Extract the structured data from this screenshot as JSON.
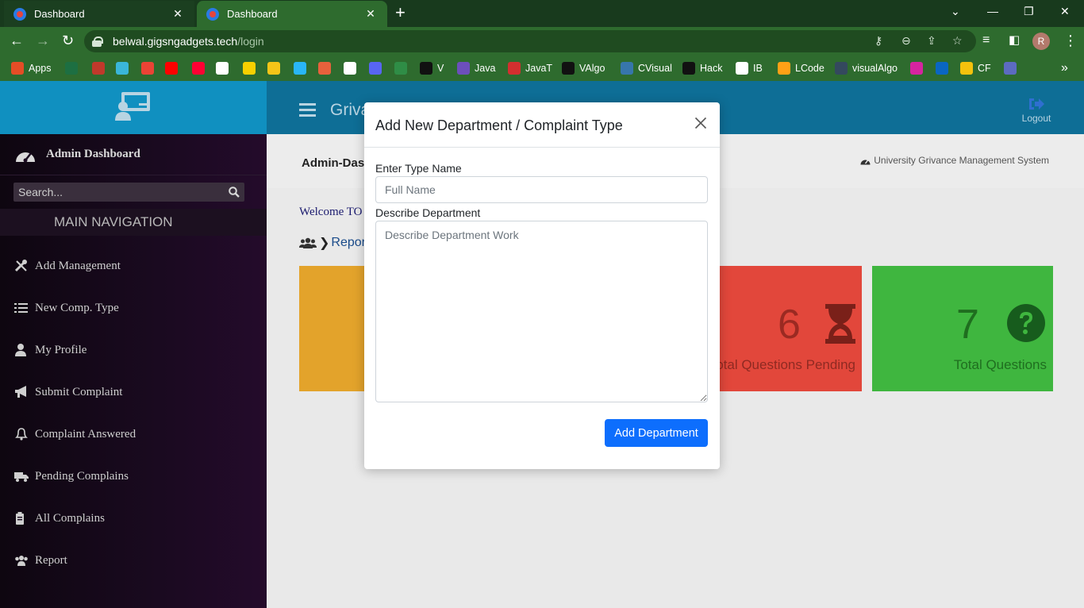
{
  "browser": {
    "tabs": [
      {
        "title": "Dashboard",
        "active": false
      },
      {
        "title": "Dashboard",
        "active": true
      }
    ],
    "url_host": "belwal.gigsngadgets.tech",
    "url_path": "/login",
    "profile_initial": "R",
    "bookmarks": [
      {
        "label": "Apps",
        "icon": "apps-grid-icon",
        "color": "#e44d26"
      },
      {
        "label": "",
        "icon": "excel-icon",
        "color": "#1d6f42"
      },
      {
        "label": "",
        "icon": "bookmark-red-icon",
        "color": "#c0392b"
      },
      {
        "label": "",
        "icon": "bookmark-teal-icon",
        "color": "#3ab6d9"
      },
      {
        "label": "",
        "icon": "gmail-icon",
        "color": "#ea4335"
      },
      {
        "label": "",
        "icon": "youtube-icon",
        "color": "#ff0000"
      },
      {
        "label": "",
        "icon": "youtube-music-icon",
        "color": "#ff0033"
      },
      {
        "label": "",
        "icon": "amazon-icon",
        "color": "#ffffff"
      },
      {
        "label": "",
        "icon": "flipkart-icon",
        "color": "#f7d000"
      },
      {
        "label": "",
        "icon": "p-icon",
        "color": "#f5c518"
      },
      {
        "label": "",
        "icon": "arrow-bookmark-icon",
        "color": "#29b6f6"
      },
      {
        "label": "",
        "icon": "code-icon",
        "color": "#e8613c"
      },
      {
        "label": "",
        "icon": "github-icon",
        "color": "#ffffff"
      },
      {
        "label": "",
        "icon": "discord-icon",
        "color": "#5865f2"
      },
      {
        "label": "",
        "icon": "gfg-icon",
        "color": "#2f8d46"
      },
      {
        "label": "V",
        "icon": "v-icon",
        "color": "#111111"
      },
      {
        "label": "Java",
        "icon": "java-icon",
        "color": "#6c4fbb"
      },
      {
        "label": "JavaT",
        "icon": "javat-icon",
        "color": "#d32f2f"
      },
      {
        "label": "VAlgo",
        "icon": "valgo-icon",
        "color": "#111111"
      },
      {
        "label": "CVisual",
        "icon": "python-icon",
        "color": "#3776ab"
      },
      {
        "label": "Hack",
        "icon": "hackerrank-icon",
        "color": "#111111"
      },
      {
        "label": "IB",
        "icon": "ib-icon",
        "color": "#ffffff"
      },
      {
        "label": "LCode",
        "icon": "leetcode-icon",
        "color": "#ffa116"
      },
      {
        "label": "visualAlgo",
        "icon": "visualalgo-icon",
        "color": "#34495e"
      },
      {
        "label": "",
        "icon": "instagram-icon",
        "color": "#d6249f"
      },
      {
        "label": "",
        "icon": "linkedin-icon",
        "color": "#0a66c2"
      },
      {
        "label": "CF",
        "icon": "codeforces-icon",
        "color": "#f4c20d"
      },
      {
        "label": "",
        "icon": "bookmark-misc-icon",
        "color": "#5c6bc0"
      }
    ]
  },
  "app": {
    "brand": "Griva",
    "logout_label": "Logout",
    "header_color": "#1090c0",
    "header_right_color": "#0e6e96"
  },
  "sidebar": {
    "dashboard_label": "Admin Dashboard",
    "search_placeholder": "Search...",
    "section_title": "MAIN NAVIGATION",
    "items": [
      {
        "label": "Add Management",
        "icon": "tools-icon"
      },
      {
        "label": "New Comp. Type",
        "icon": "list-icon"
      },
      {
        "label": "My Profile",
        "icon": "user-icon"
      },
      {
        "label": "Submit Complaint",
        "icon": "megaphone-icon"
      },
      {
        "label": "Complaint Answered",
        "icon": "bell-icon"
      },
      {
        "label": "Pending Complains",
        "icon": "truck-icon"
      },
      {
        "label": "All Complains",
        "icon": "clipboard-icon"
      },
      {
        "label": "Report",
        "icon": "users-icon"
      }
    ]
  },
  "content": {
    "page_title": "Admin-Dashboard",
    "system_name": "University Grivance Management System",
    "welcome": "Welcome TO",
    "crumb": "Report",
    "cards": [
      {
        "number": "",
        "label": "",
        "color": "#e3a32b"
      },
      {
        "number": "6",
        "label": "Total Questions Pending",
        "color": "#e2473b"
      },
      {
        "number": "7",
        "label": "Total Questions",
        "color": "#3fb63f"
      }
    ]
  },
  "modal": {
    "title": "Add New Department / Complaint Type",
    "type_label": "Enter Type Name",
    "type_placeholder": "Full Name",
    "type_value": "",
    "desc_label": "Describe Department",
    "desc_placeholder": "Describe Department Work",
    "desc_value": "",
    "submit_label": "Add Department"
  }
}
